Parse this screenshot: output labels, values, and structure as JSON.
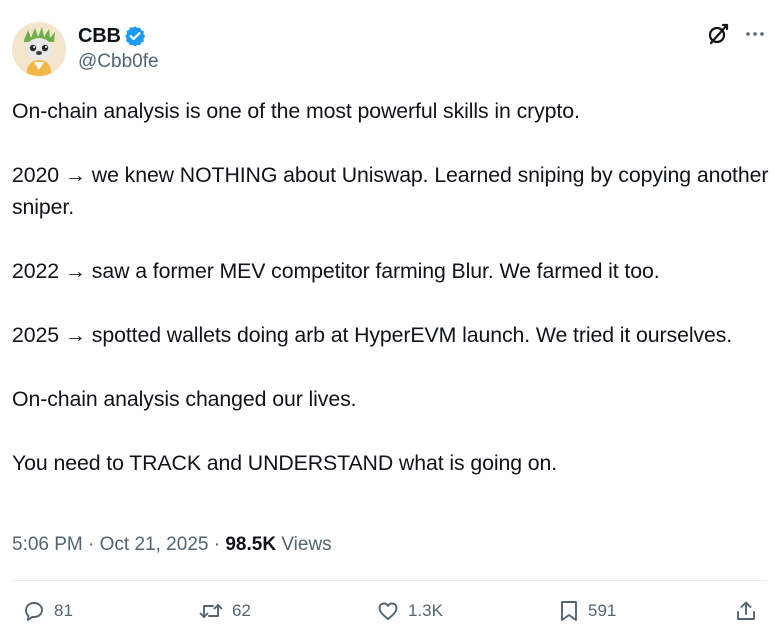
{
  "author": {
    "display_name": "CBB",
    "handle": "@Cbb0fe",
    "verified": true,
    "avatar_icon": "avatar-icon"
  },
  "tweet": {
    "paragraphs": [
      "On-chain analysis is one of the most powerful skills in crypto.",
      "2020 → we knew NOTHING about Uniswap. Learned sniping by copying another sniper.",
      "2022 → saw a former MEV competitor farming Blur. We farmed it too.",
      "2025 → spotted wallets doing arb at HyperEVM launch. We tried it ourselves.",
      "On-chain analysis changed our lives.",
      "You need to TRACK and UNDERSTAND what is going on."
    ]
  },
  "meta": {
    "time": "5:06 PM",
    "separator": "·",
    "date": "Oct 21, 2025",
    "views_count": "98.5K",
    "views_label": "Views"
  },
  "actions": {
    "replies": "81",
    "reposts": "62",
    "likes": "1.3K",
    "bookmarks": "591"
  },
  "colors": {
    "text_primary": "#0f1419",
    "text_secondary": "#536471",
    "verified_blue": "#1d9bf0",
    "divider": "#e6ecf0"
  }
}
